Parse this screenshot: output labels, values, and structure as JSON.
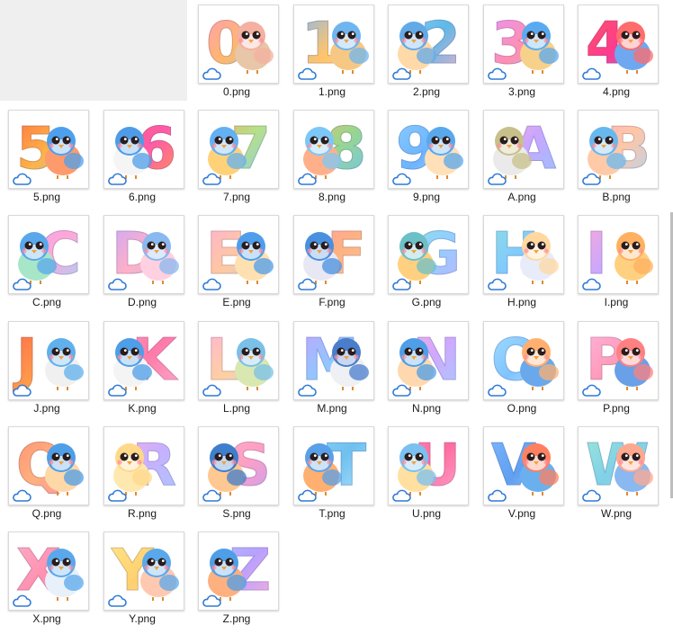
{
  "colors": {
    "tile_border": "#d9d9d9",
    "placeholder": "#efefef",
    "cloud": "#2f7ad6",
    "label": "#1a1a1a"
  },
  "files": [
    {
      "name": "0.png",
      "glyph": "0",
      "glyph_fill": "linear-gradient(135deg,#ff9ac0,#ffb86b,#8ad0ff)",
      "bird_head": "#f4b0a0",
      "bird_body": "#e8c6a8",
      "bird_side": "right",
      "cloud_icon": "cloud-icon"
    },
    {
      "name": "1.png",
      "glyph": "1",
      "glyph_fill": "linear-gradient(135deg,#7ab8ff,#ffc46b,#ffd27a)",
      "bird_head": "#6fb5f0",
      "bird_body": "#f6c884",
      "bird_side": "right",
      "cloud_icon": "cloud-icon"
    },
    {
      "name": "2.png",
      "glyph": "2",
      "glyph_fill": "linear-gradient(135deg,#9fd8ff,#5fb8e6,#ffb0c8)",
      "bird_head": "#62a9e8",
      "bird_body": "#ffd9a8",
      "bird_side": "left",
      "cloud_icon": "cloud-icon"
    },
    {
      "name": "3.png",
      "glyph": "3",
      "glyph_fill": "linear-gradient(135deg,#e496ff,#ff8fb0,#9fc0ff)",
      "bird_head": "#5aaaf0",
      "bird_body": "#f7d08a",
      "bird_side": "right",
      "cloud_icon": "cloud-icon"
    },
    {
      "name": "4.png",
      "glyph": "4",
      "glyph_fill": "linear-gradient(135deg,#ff5b5b,#ff3a8f,#5f8fff)",
      "bird_head": "#ff6c6c",
      "bird_body": "#6fa8f0",
      "bird_side": "right",
      "cloud_icon": "cloud-icon"
    },
    {
      "name": "5.png",
      "glyph": "5",
      "glyph_fill": "linear-gradient(135deg,#ff6d3f,#ffb347,#7ac8ff)",
      "bird_head": "#4ea0ee",
      "bird_body": "#ff9a6c",
      "bird_side": "right",
      "cloud_icon": "cloud-icon"
    },
    {
      "name": "6.png",
      "glyph": "6",
      "glyph_fill": "linear-gradient(135deg,#ff6a6a,#ff5aa8,#ff9a4f)",
      "bird_head": "#4e9ce8",
      "bird_body": "#f5f5f5",
      "bird_side": "left",
      "cloud_icon": "cloud-icon"
    },
    {
      "name": "7.png",
      "glyph": "7",
      "glyph_fill": "linear-gradient(135deg,#ffa24f,#b6e08a,#7fc7ff)",
      "bird_head": "#63b0f2",
      "bird_body": "#ffd27a",
      "bird_side": "left",
      "cloud_icon": "cloud-icon"
    },
    {
      "name": "8.png",
      "glyph": "8",
      "glyph_fill": "linear-gradient(135deg,#ffb46b,#9ad68c,#6cc2ff)",
      "bird_head": "#7bc8f7",
      "bird_body": "#ffb08a",
      "bird_side": "left",
      "cloud_icon": "cloud-icon"
    },
    {
      "name": "9.png",
      "glyph": "9",
      "glyph_fill": "linear-gradient(135deg,#8fd0ff,#6cb4ff,#c8e6ff)",
      "bird_head": "#5aa8ec",
      "bird_body": "#ffe0b8",
      "bird_side": "right",
      "cloud_icon": "cloud-icon"
    },
    {
      "name": "A.png",
      "glyph": "A",
      "glyph_fill": "linear-gradient(135deg,#ffb0d0,#c9a6ff,#8fc8ff)",
      "bird_head": "#c8c08a",
      "bird_body": "#eaeaea",
      "bird_side": "left",
      "cloud_icon": "cloud-icon"
    },
    {
      "name": "B.png",
      "glyph": "B",
      "glyph_fill": "linear-gradient(135deg,#ffb0c4,#ffc6a6,#a8d6ff)",
      "bird_head": "#68b8f0",
      "bird_body": "#ffcaa8",
      "bird_side": "left",
      "cloud_icon": "cloud-icon"
    },
    {
      "name": "C.png",
      "glyph": "C",
      "glyph_fill": "linear-gradient(135deg,#d8a8ff,#ffa8d6,#9ad8ff)",
      "bird_head": "#59a8ec",
      "bird_body": "#a8e6c8",
      "bird_side": "left",
      "cloud_icon": "cloud-icon"
    },
    {
      "name": "D.png",
      "glyph": "D",
      "glyph_fill": "linear-gradient(135deg,#c4a8ff,#ffb0c8,#8fc8ff)",
      "bird_head": "#8ab8f0",
      "bird_body": "#ffd0e0",
      "bird_side": "right",
      "cloud_icon": "cloud-icon"
    },
    {
      "name": "E.png",
      "glyph": "E",
      "glyph_fill": "linear-gradient(135deg,#ffb0d8,#ffc8a0,#a8d8ff)",
      "bird_head": "#4e9eec",
      "bird_body": "#ffe0b0",
      "bird_side": "right",
      "cloud_icon": "cloud-icon"
    },
    {
      "name": "F.png",
      "glyph": "F",
      "glyph_fill": "linear-gradient(135deg,#ffa0c0,#ffb080,#ffd0a0)",
      "bird_head": "#4a90e0",
      "bird_body": "#e8e8f4",
      "bird_side": "left",
      "cloud_icon": "cloud-icon"
    },
    {
      "name": "G.png",
      "glyph": "G",
      "glyph_fill": "linear-gradient(135deg,#9ee0c8,#8fd0ff,#c8b0ff)",
      "bird_head": "#6cc0c8",
      "bird_body": "#ffd080",
      "bird_side": "left",
      "cloud_icon": "cloud-icon"
    },
    {
      "name": "H.png",
      "glyph": "H",
      "glyph_fill": "linear-gradient(135deg,#8fe0e0,#80c8ff,#b8a8ff)",
      "bird_head": "#ffd8a0",
      "bird_body": "#e8ecf8",
      "bird_side": "right",
      "cloud_icon": "cloud-icon"
    },
    {
      "name": "I.png",
      "glyph": "I",
      "glyph_fill": "linear-gradient(135deg,#ffa8d8,#c8a8ff,#8fc0ff)",
      "bird_head": "#ffb060",
      "bird_body": "#ffd080",
      "bird_side": "right",
      "cloud_icon": "cloud-icon"
    },
    {
      "name": "J.png",
      "glyph": "J",
      "glyph_fill": "linear-gradient(135deg,#ff6a4a,#ff9a4a,#ffd04a)",
      "bird_head": "#5fb0ec",
      "bird_body": "#f0f0f0",
      "bird_side": "right",
      "cloud_icon": "cloud-icon"
    },
    {
      "name": "K.png",
      "glyph": "K",
      "glyph_fill": "linear-gradient(135deg,#ff9ac0,#ff7aa8,#ffb0d0)",
      "bird_head": "#4e9ee8",
      "bird_body": "#f4f4f4",
      "bird_side": "left",
      "cloud_icon": "cloud-icon"
    },
    {
      "name": "L.png",
      "glyph": "L",
      "glyph_fill": "linear-gradient(135deg,#ffb0e0,#ffd0a0,#b0d8ff)",
      "bird_head": "#7ac0e8",
      "bird_body": "#d8e8b0",
      "bird_side": "right",
      "cloud_icon": "cloud-icon"
    },
    {
      "name": "M.png",
      "glyph": "M",
      "glyph_fill": "linear-gradient(135deg,#c8a0ff,#8fc8ff,#ffa0c8)",
      "bird_head": "#4a7ecc",
      "bird_body": "#eef0f4",
      "bird_side": "right",
      "cloud_icon": "cloud-icon"
    },
    {
      "name": "N.png",
      "glyph": "N",
      "glyph_fill": "linear-gradient(135deg,#ffb0d0,#d0a8ff,#a0d0ff)",
      "bird_head": "#4e9ee8",
      "bird_body": "#ffd8b0",
      "bird_side": "left",
      "cloud_icon": "cloud-icon"
    },
    {
      "name": "O.png",
      "glyph": "O",
      "glyph_fill": "linear-gradient(135deg,#a8e0ff,#80c4ff,#d8f0ff)",
      "bird_head": "#ffb070",
      "bird_body": "#6aa8ec",
      "bird_side": "right",
      "cloud_icon": "cloud-icon"
    },
    {
      "name": "P.png",
      "glyph": "P",
      "glyph_fill": "linear-gradient(135deg,#ffb8e0,#ff9ab8,#c8d0ff)",
      "bird_head": "#ff8080",
      "bird_body": "#6aa0e8",
      "bird_side": "right",
      "cloud_icon": "cloud-icon"
    },
    {
      "name": "Q.png",
      "glyph": "Q",
      "glyph_fill": "linear-gradient(135deg,#ff9070,#ffb080,#ff8aa8)",
      "bird_head": "#4e9ee8",
      "bird_body": "#ffd8a8",
      "bird_side": "right",
      "cloud_icon": "cloud-icon"
    },
    {
      "name": "R.png",
      "glyph": "R",
      "glyph_fill": "linear-gradient(135deg,#ffb0d8,#c8b0ff,#a8c8ff)",
      "bird_head": "#ffd88a",
      "bird_body": "#ffe8b0",
      "bird_side": "left",
      "cloud_icon": "cloud-icon"
    },
    {
      "name": "S.png",
      "glyph": "S",
      "glyph_fill": "linear-gradient(135deg,#ffb0e0,#ffa0c0,#c0a0ff)",
      "bird_head": "#3f7ecc",
      "bird_body": "#ffc890",
      "bird_side": "left",
      "cloud_icon": "cloud-icon"
    },
    {
      "name": "T.png",
      "glyph": "T",
      "glyph_fill": "linear-gradient(135deg,#90d8ff,#6fc0f0,#b8e8ff)",
      "bird_head": "#5aa0e8",
      "bird_body": "#ffb070",
      "bird_side": "left",
      "cloud_icon": "cloud-icon"
    },
    {
      "name": "U.png",
      "glyph": "U",
      "glyph_fill": "linear-gradient(135deg,#ff8ab8,#ff6ca0,#ffb0d0)",
      "bird_head": "#7ac0f0",
      "bird_body": "#ffe0a0",
      "bird_side": "left",
      "cloud_icon": "cloud-icon"
    },
    {
      "name": "V.png",
      "glyph": "V",
      "glyph_fill": "linear-gradient(135deg,#7fb8ff,#5fa0f0,#c0d8ff)",
      "bird_head": "#ff8060",
      "bird_body": "#6ab0ee",
      "bird_side": "right",
      "cloud_icon": "cloud-icon"
    },
    {
      "name": "W.png",
      "glyph": "W",
      "glyph_fill": "linear-gradient(135deg,#9ee8d8,#80d0e8,#b8e8d0)",
      "bird_head": "#ffa890",
      "bird_body": "#8ab8f0",
      "bird_side": "right",
      "cloud_icon": "cloud-icon"
    },
    {
      "name": "X.png",
      "glyph": "X",
      "glyph_fill": "linear-gradient(135deg,#ffb0c8,#ff90b0,#ffc8d8)",
      "bird_head": "#5aa8ec",
      "bird_body": "#e8f0fa",
      "bird_side": "right",
      "cloud_icon": "cloud-icon"
    },
    {
      "name": "Y.png",
      "glyph": "Y",
      "glyph_fill": "linear-gradient(135deg,#ffe88a,#ffd070,#ffe0a0)",
      "bird_head": "#5aa8ec",
      "bird_body": "#ffc8b0",
      "bird_side": "right",
      "cloud_icon": "cloud-icon"
    },
    {
      "name": "Z.png",
      "glyph": "Z",
      "glyph_fill": "linear-gradient(135deg,#a8c8ff,#b8a0ff,#ffb0d8)",
      "bird_head": "#4e9ee8",
      "bird_body": "#ffb080",
      "bird_side": "left",
      "cloud_icon": "cloud-icon"
    }
  ]
}
